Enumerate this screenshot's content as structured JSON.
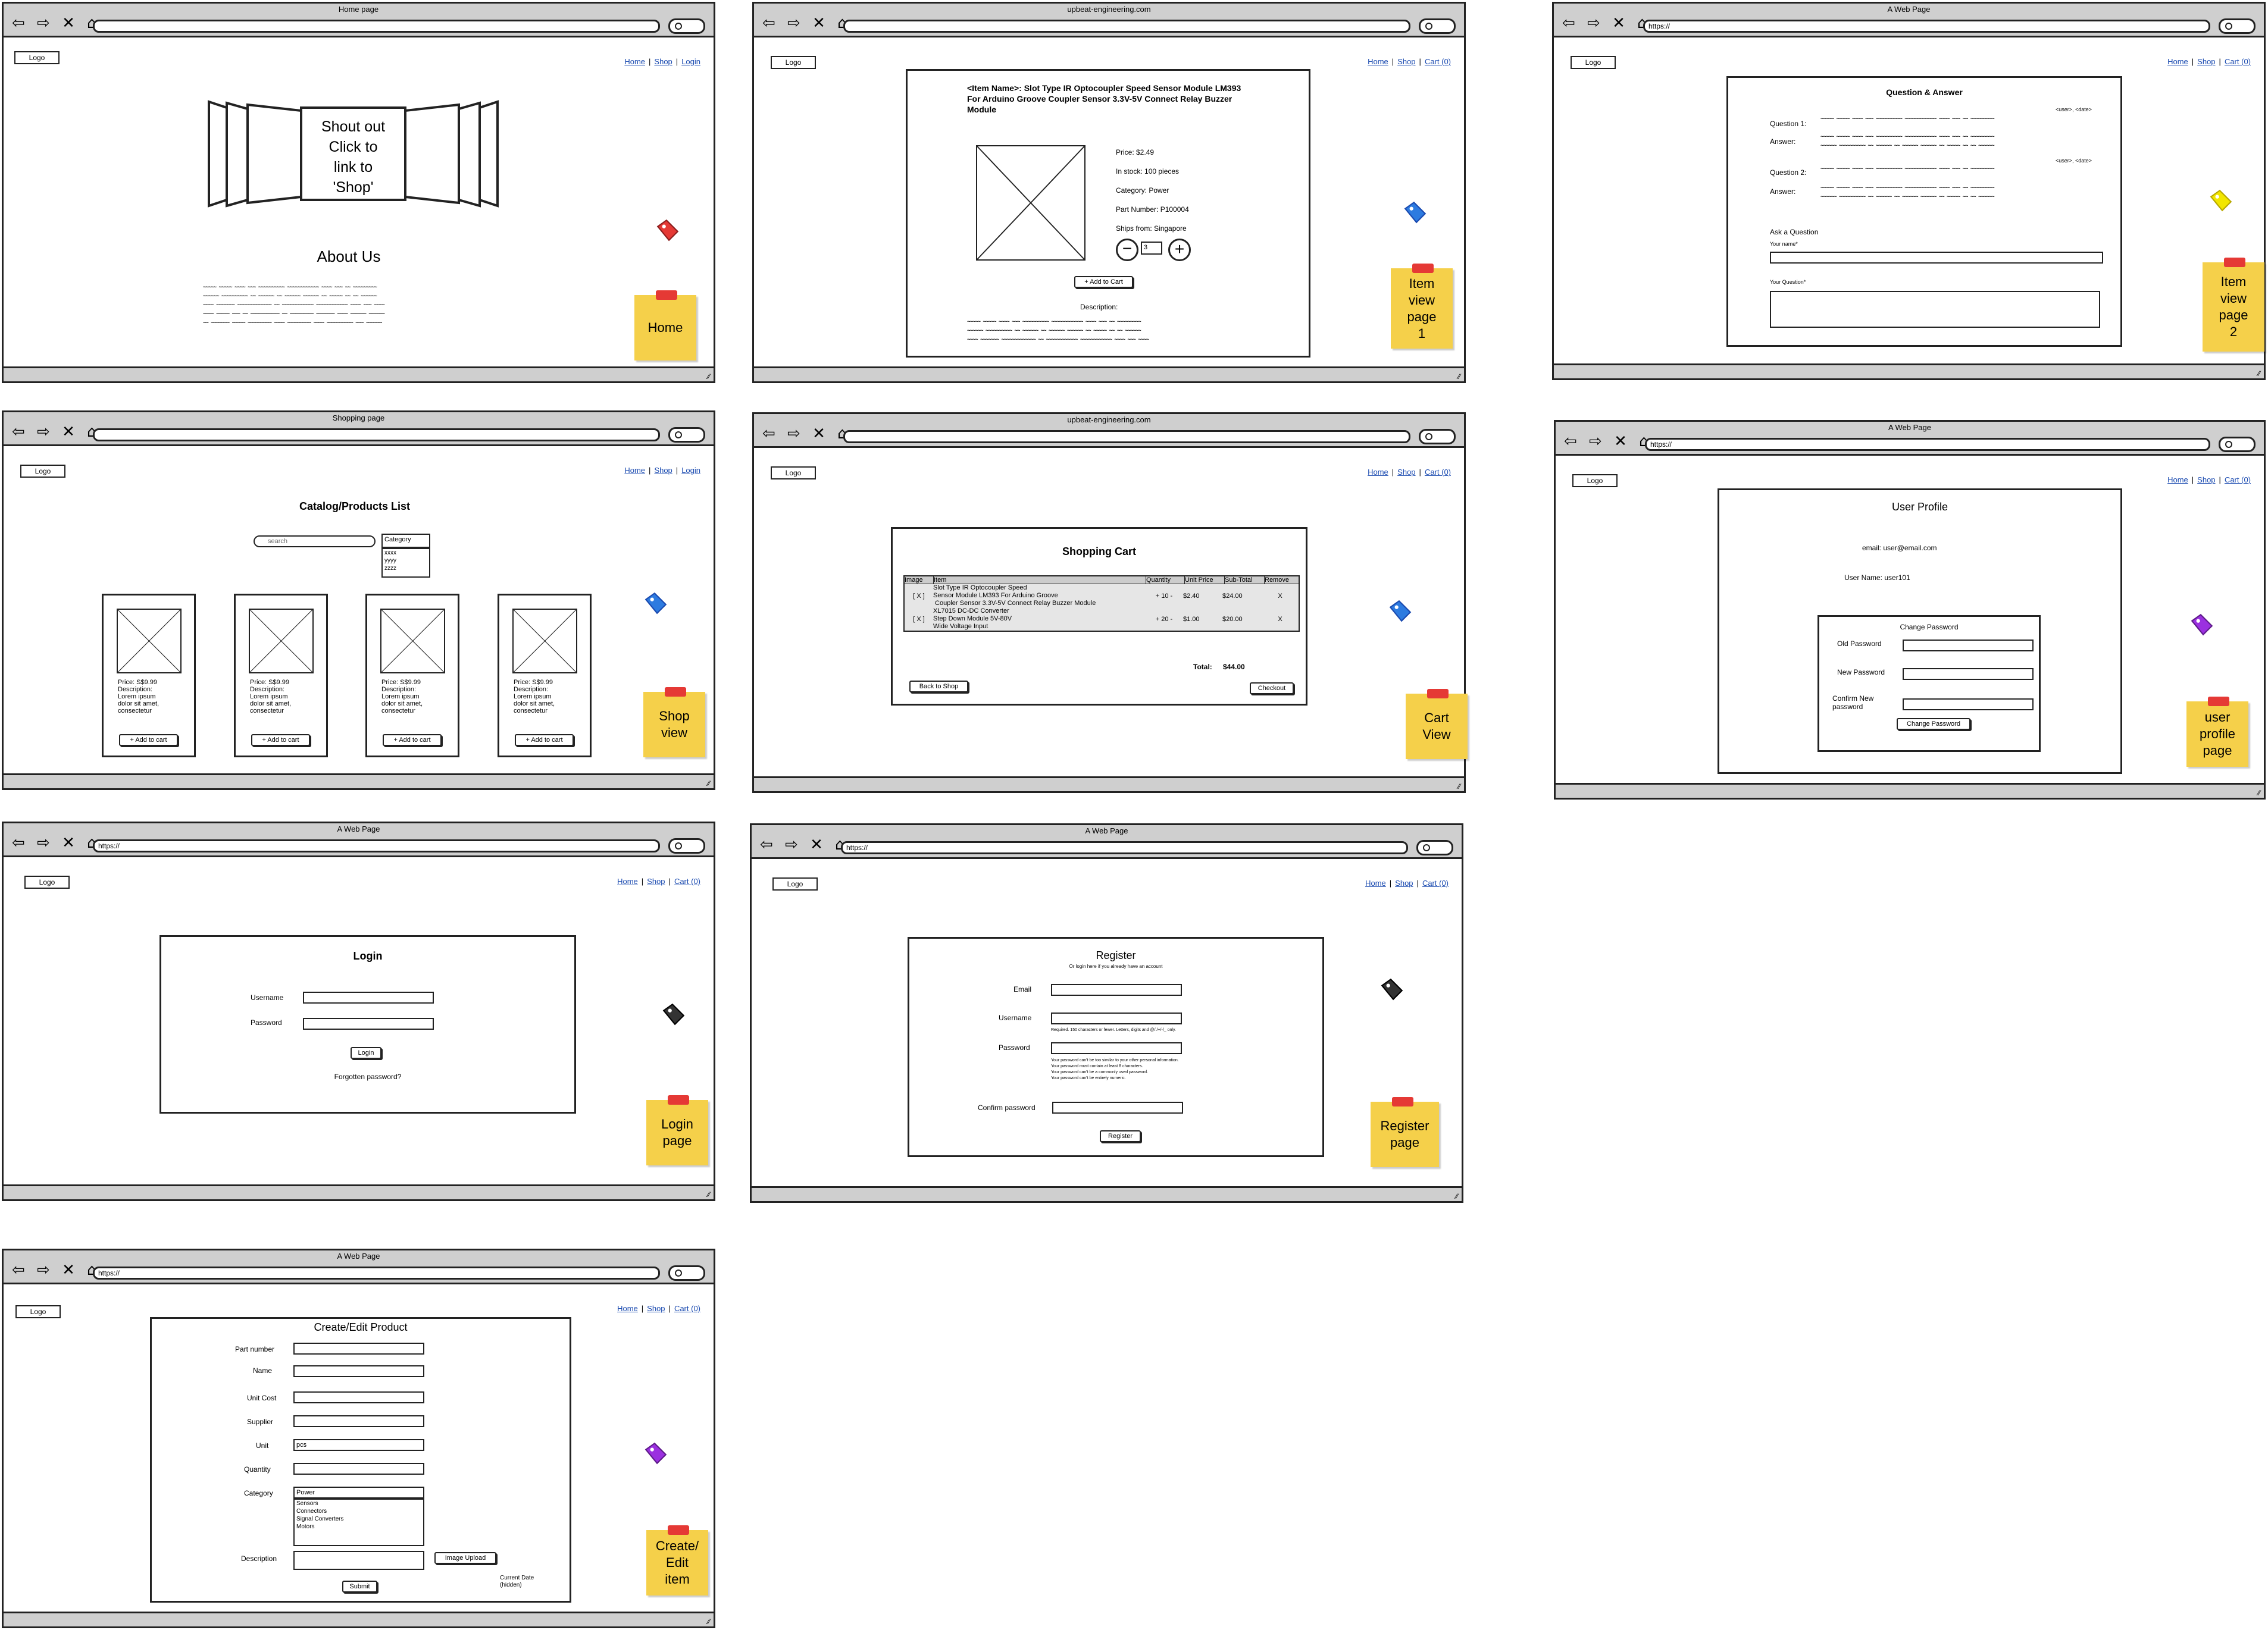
{
  "common": {
    "logo": "Logo",
    "nav_buttons": "⇦ ⇨ ✕ ⌂",
    "scribble": "~~~~~ ~~~~~ ~~~~ ~~~ ~~~~~~~~~~ ~~~~~~~~~~~~ ~~~~ ~~~ ~~ ~~~~~~~~~\n~~~~~~ ~~~~~~~~~~ ~~ ~~~~~~ ~~ ~~~~~~ ~~~~~~ ~~ ~~~~~ ~~ ~~ ~~~~~~\n~~~~ ~~~~~~~ ~~~~~~~~~~~~~ ~~ ~~~~~~~~~~~~ ~~~~~~~~~~~~ ~~~~ ~~~ ~~~~\n~~~~ ~~~~~ ~~~ ~~ ~~~~~~~~~~~ ~~ ~~~~~~~~~ ~~~~~~~ ~~~~ ~~~~~~ ~~~~~~\n~~ ~~~~~~~ ~~~~~ ~~~~~~~~~ ~~~~ ~~~~~~~~~ ~~~~ ~~~~~~~~~~ ~~~ ~~~~~~"
  },
  "home": {
    "title": "Home page",
    "url": "",
    "links": [
      "Home",
      "Shop",
      "Login"
    ],
    "banner": "Shout out\nClick to\nlink to\n'Shop'",
    "about": "About Us",
    "note": "Home"
  },
  "item1": {
    "title": "upbeat-engineering.com",
    "url": "",
    "links": [
      "Home",
      "Shop",
      "Cart (0)"
    ],
    "name": "<Item Name>: Slot Type IR Optocoupler Speed Sensor Module LM393 For Arduino Groove Coupler Sensor 3.3V-5V Connect Relay Buzzer Module",
    "price": "Price: $2.49",
    "stock": "In stock: 100 pieces",
    "category": "Category: Power",
    "part": "Part Number: P100004",
    "ships": "Ships from: Singapore",
    "qty": "3",
    "add": "+ Add to Cart",
    "desc": "Description:",
    "note": "Item\nview\npage\n1"
  },
  "qa": {
    "title": "A Web Page",
    "url": "https://",
    "links": [
      "Home",
      "Shop",
      "Cart (0)"
    ],
    "heading": "Question & Answer",
    "user1": "<user>, <date>",
    "q1": "Question 1:",
    "a1": "Answer:",
    "user2": "<user>, <date>",
    "q2": "Question 2:",
    "a2": "Answer:",
    "ask": "Ask a Question",
    "name_lbl": "Your name*",
    "question_lbl": "Your Question*",
    "note": "Item\nview\npage\n2"
  },
  "shop": {
    "title": "Shopping page",
    "url": "",
    "links": [
      "Home",
      "Shop",
      "Login"
    ],
    "heading": "Catalog/Products List",
    "search_ph": "search",
    "category": "Category",
    "options": [
      "xxxx",
      "yyyy",
      "zzzz"
    ],
    "products": [
      {
        "price": "Price: S$9.99",
        "desc": "Description:\nLorem ipsum\ndolor sit amet,\nconsectetur",
        "btn": "+ Add to cart"
      },
      {
        "price": "Price: S$9.99",
        "desc": "Description:\nLorem ipsum\ndolor sit amet,\nconsectetur",
        "btn": "+ Add to cart"
      },
      {
        "price": "Price: S$9.99",
        "desc": "Description:\nLorem ipsum\ndolor sit amet,\nconsectetur",
        "btn": "+ Add to cart"
      },
      {
        "price": "Price: S$9.99",
        "desc": "Description:\nLorem ipsum\ndolor sit amet,\nconsectetur",
        "btn": "+ Add to cart"
      }
    ],
    "note": "Shop\nview"
  },
  "cart": {
    "title": "upbeat-engineering.com",
    "url": "",
    "links": [
      "Home",
      "Shop",
      "Cart (0)"
    ],
    "heading": "Shopping Cart",
    "headers": [
      "Image",
      "Item",
      "Quantity",
      "Unit Price",
      "Sub-Total",
      "Remove"
    ],
    "rows": [
      {
        "image": "[ X ]",
        "item": "Slot Type IR Optocoupler Speed\nSensor Module LM393 For Arduino Groove\n Coupler Sensor 3.3V-5V Connect Relay Buzzer Module",
        "qty": "+ 10 -",
        "unit": "$2.40",
        "sub": "$24.00",
        "remove": "X"
      },
      {
        "image": "[ X ]",
        "item": "XL7015 DC-DC Converter\nStep Down Module 5V-80V\nWide Voltage Input",
        "qty": "+ 20 -",
        "unit": "$1.00",
        "sub": "$20.00",
        "remove": "X"
      }
    ],
    "total_lbl": "Total:",
    "total": "$44.00",
    "back": "Back to Shop",
    "checkout": "Checkout",
    "note": "Cart\nView"
  },
  "profile": {
    "title": "A Web Page",
    "url": "https://",
    "links": [
      "Home",
      "Shop",
      "Cart (0)"
    ],
    "heading": "User Profile",
    "email": "email:   user@email.com",
    "username": "User Name: user101",
    "change": "Change Password",
    "old": "Old Password",
    "new": "New Password",
    "confirm": "Confirm New\npassword",
    "btn": "Change Password",
    "note": "user\nprofile\npage"
  },
  "login": {
    "title": "A Web Page",
    "url": "https://",
    "links": [
      "Home",
      "Shop",
      "Cart (0)"
    ],
    "heading": "Login",
    "user": "Username",
    "pass": "Password",
    "btn": "Login",
    "forgot": "Forgotten password?",
    "note": "Login\npage"
  },
  "register": {
    "title": "A Web Page",
    "url": "https://",
    "links": [
      "Home",
      "Shop",
      "Cart (0)"
    ],
    "heading": "Register",
    "sub": "Or login here if you already have an account",
    "email": "Email",
    "user": "Username",
    "user_hint": "Required. 150 characters or fewer. Letters, digits and @/./+/-/_ only.",
    "pass": "Password",
    "pass_hint": "Your password can't be too similar to your other personal information.\nYour password must contain at least 8 characters.\nYour password can't be a commonly used password.\nYour password can't be entirely numeric.",
    "confirm": "Confirm password",
    "btn": "Register",
    "note": "Register\npage"
  },
  "create": {
    "title": "A Web Page",
    "url": "https://",
    "links": [
      "Home",
      "Shop",
      "Cart (0)"
    ],
    "heading": "Create/Edit Product",
    "part": "Part number",
    "name": "Name",
    "cost": "Unit Cost",
    "supplier": "Supplier",
    "unit": "Unit",
    "unit_val": "pcs",
    "qty": "Quantity",
    "category": "Category",
    "cat_val": "Power",
    "cat_options": "Sensors\nConnectors\nSignal Converters\nMotors",
    "desc": "Description",
    "upload": "Image Upload",
    "submit": "Submit",
    "date": "Current Date\n(hidden)",
    "note": "Create/\nEdit\nitem"
  },
  "colors": {
    "tag_red": "#e53935",
    "tag_blue": "#2d7be0",
    "tag_yellow": "#f2e600",
    "tag_purple": "#9b30e0",
    "tag_dark": "#333333",
    "note": "#f5d04a",
    "link": "#1a4ab0"
  }
}
